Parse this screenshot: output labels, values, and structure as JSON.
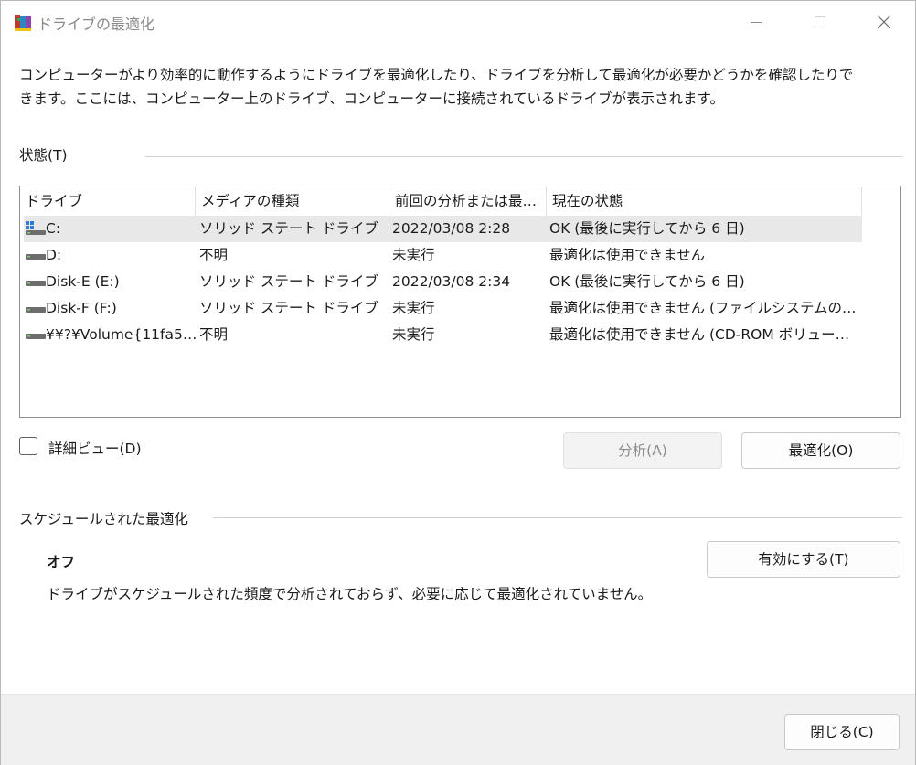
{
  "window": {
    "title": "ドライブの最適化",
    "icon": "defrag-app-icon"
  },
  "description": "コンピューターがより効率的に動作するようにドライブを最適化したり、ドライブを分析して最適化が必要かどうかを確認したりできます。ここには、コンピューター上のドライブ、コンピューターに接続されているドライブが表示されます。",
  "status_section": {
    "label": "状態(T)",
    "columns": [
      "ドライブ",
      "メディアの種類",
      "前回の分析または最…",
      "現在の状態"
    ],
    "rows": [
      {
        "drive": "C:",
        "media": "ソリッド ステート ドライブ",
        "last": "2022/03/08 2:28",
        "status": "OK (最後に実行してから 6 日)",
        "icon": "system-drive-icon",
        "selected": true
      },
      {
        "drive": "D:",
        "media": "不明",
        "last": "未実行",
        "status": "最適化は使用できません",
        "icon": "drive-icon",
        "selected": false
      },
      {
        "drive": "Disk-E (E:)",
        "media": "ソリッド ステート ドライブ",
        "last": "2022/03/08 2:34",
        "status": "OK (最後に実行してから 6 日)",
        "icon": "drive-icon",
        "selected": false
      },
      {
        "drive": "Disk-F (F:)",
        "media": "ソリッド ステート ドライブ",
        "last": "未実行",
        "status": "最適化は使用できません (ファイルシステムの…",
        "icon": "drive-icon",
        "selected": false
      },
      {
        "drive": "¥¥?¥Volume{11fa5…",
        "media": "不明",
        "last": "未実行",
        "status": "最適化は使用できません (CD-ROM ボリュー…",
        "icon": "drive-icon",
        "selected": false
      }
    ]
  },
  "detail_view": {
    "label": "詳細ビュー(D)",
    "checked": false
  },
  "buttons": {
    "analyze": "分析(A)",
    "optimize": "最適化(O)",
    "enable": "有効にする(T)",
    "close": "閉じる(C)"
  },
  "schedule_section": {
    "label": "スケジュールされた最適化",
    "state": "オフ",
    "description": "ドライブがスケジュールされた頻度で分析されておらず、必要に応じて最適化されていません。"
  },
  "colors": {
    "selected_row": "#e8e8e8",
    "footer": "#f0f0f0",
    "disabled_text": "#8c8c8c",
    "title_text": "#8a8a8a"
  }
}
